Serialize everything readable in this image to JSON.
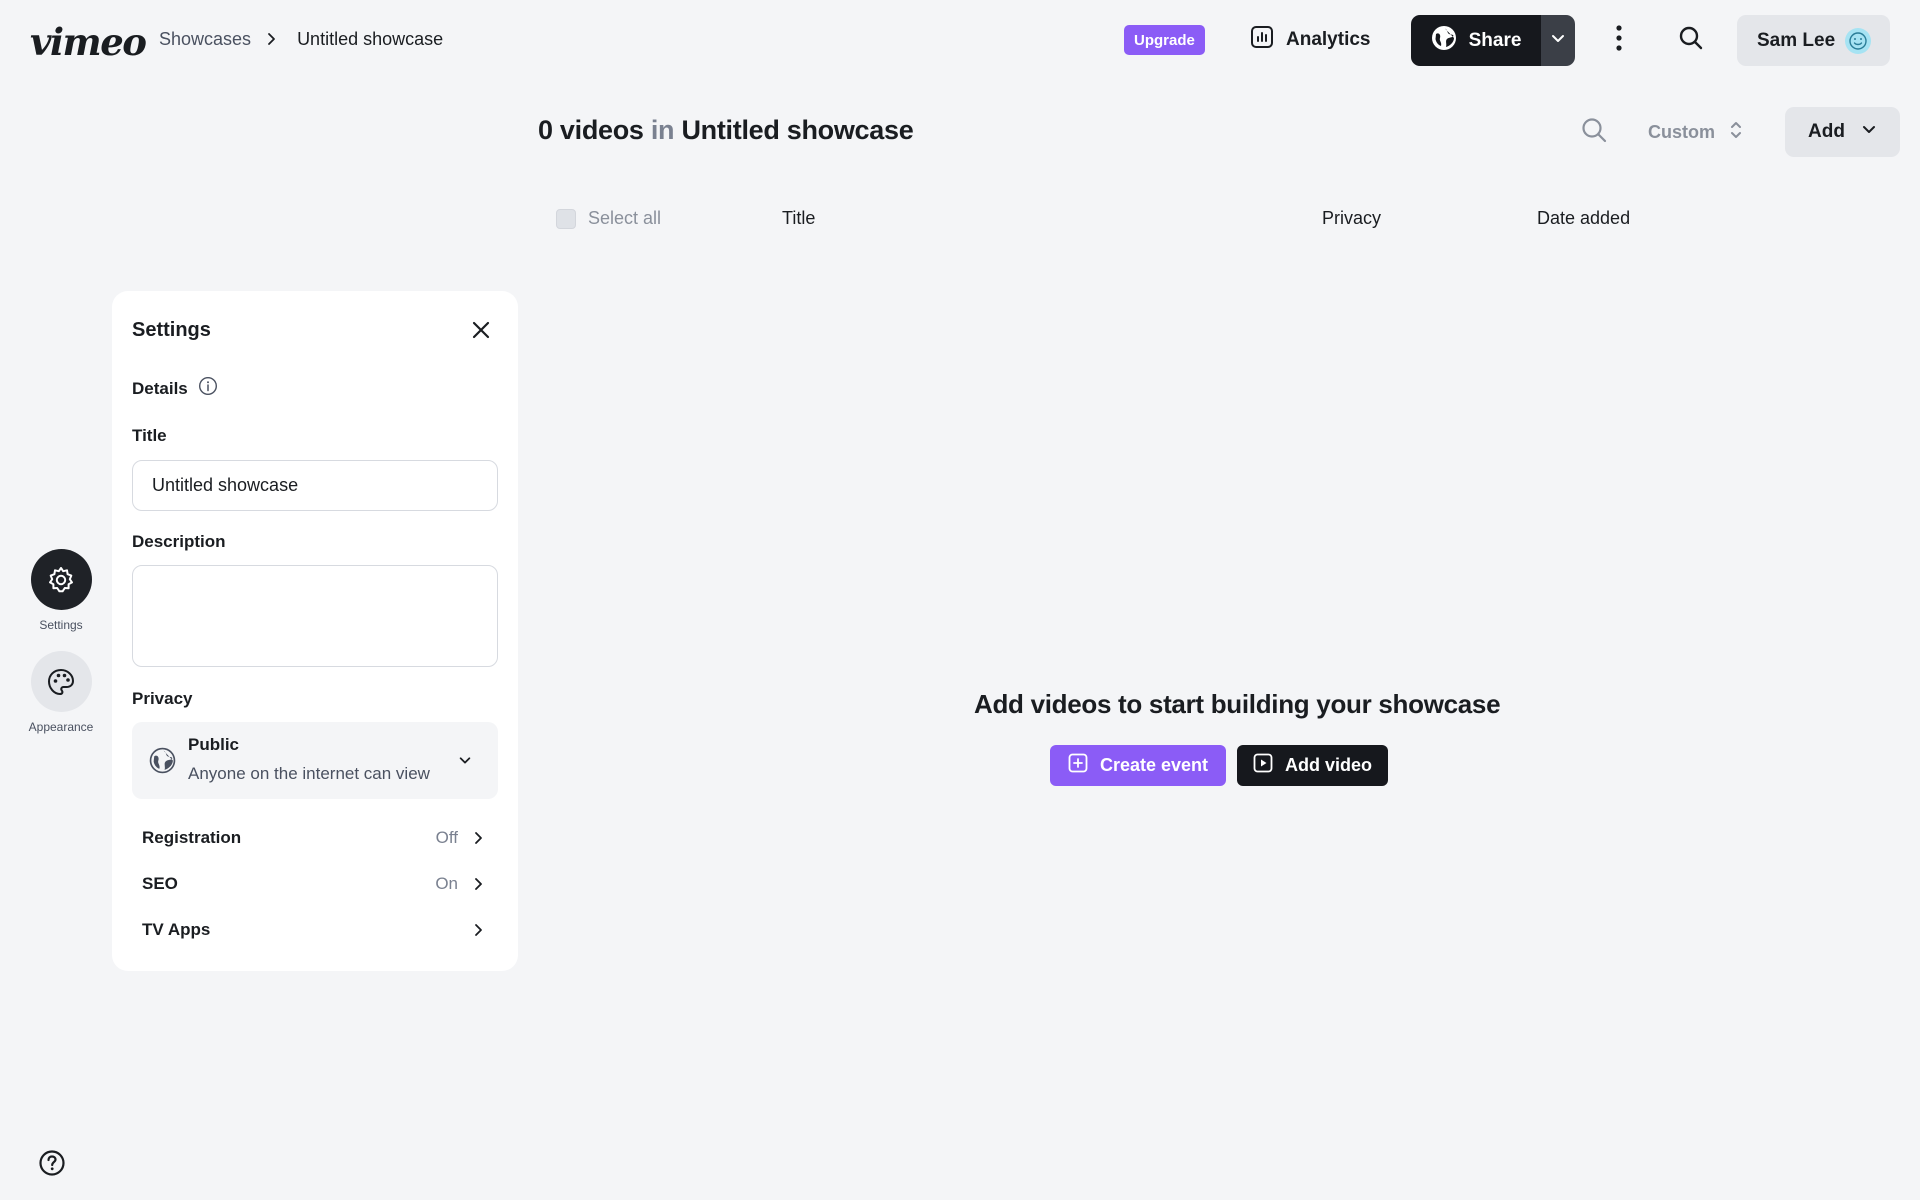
{
  "header": {
    "logo_text": "vimeo",
    "breadcrumb": {
      "parent": "Showcases",
      "current": "Untitled showcase"
    },
    "upgrade_label": "Upgrade",
    "analytics_label": "Analytics",
    "share_label": "Share",
    "user_name": "Sam Lee"
  },
  "toolbar": {
    "title_count": "0 videos",
    "title_in": "in",
    "title_name": "Untitled showcase",
    "sort_label": "Custom",
    "add_label": "Add"
  },
  "table": {
    "select_all_label": "Select all",
    "columns": [
      "Title",
      "Privacy",
      "Date added"
    ]
  },
  "rail": {
    "settings_label": "Settings",
    "appearance_label": "Appearance"
  },
  "settings_panel": {
    "title": "Settings",
    "details_label": "Details",
    "title_label": "Title",
    "title_value": "Untitled showcase",
    "description_label": "Description",
    "description_value": "",
    "privacy_label": "Privacy",
    "privacy_value": "Public",
    "privacy_desc": "Anyone on the internet can view",
    "rows": [
      {
        "name": "Registration",
        "value": "Off"
      },
      {
        "name": "SEO",
        "value": "On"
      },
      {
        "name": "TV Apps",
        "value": ""
      }
    ]
  },
  "empty_state": {
    "heading": "Add videos to start building your showcase",
    "create_event_label": "Create event",
    "add_video_label": "Add video"
  },
  "colors": {
    "accent_purple": "#8b5cf6",
    "dark": "#16181d",
    "background": "#f4f5f7"
  },
  "icons": [
    "chevron-right-icon",
    "analytics-icon",
    "globe-icon",
    "chevron-down-icon",
    "more-vertical-icon",
    "search-icon",
    "avatar-smile-icon",
    "sort-icon",
    "gear-icon",
    "palette-icon",
    "help-icon",
    "close-icon",
    "info-icon",
    "plus-square-icon",
    "play-square-icon"
  ]
}
